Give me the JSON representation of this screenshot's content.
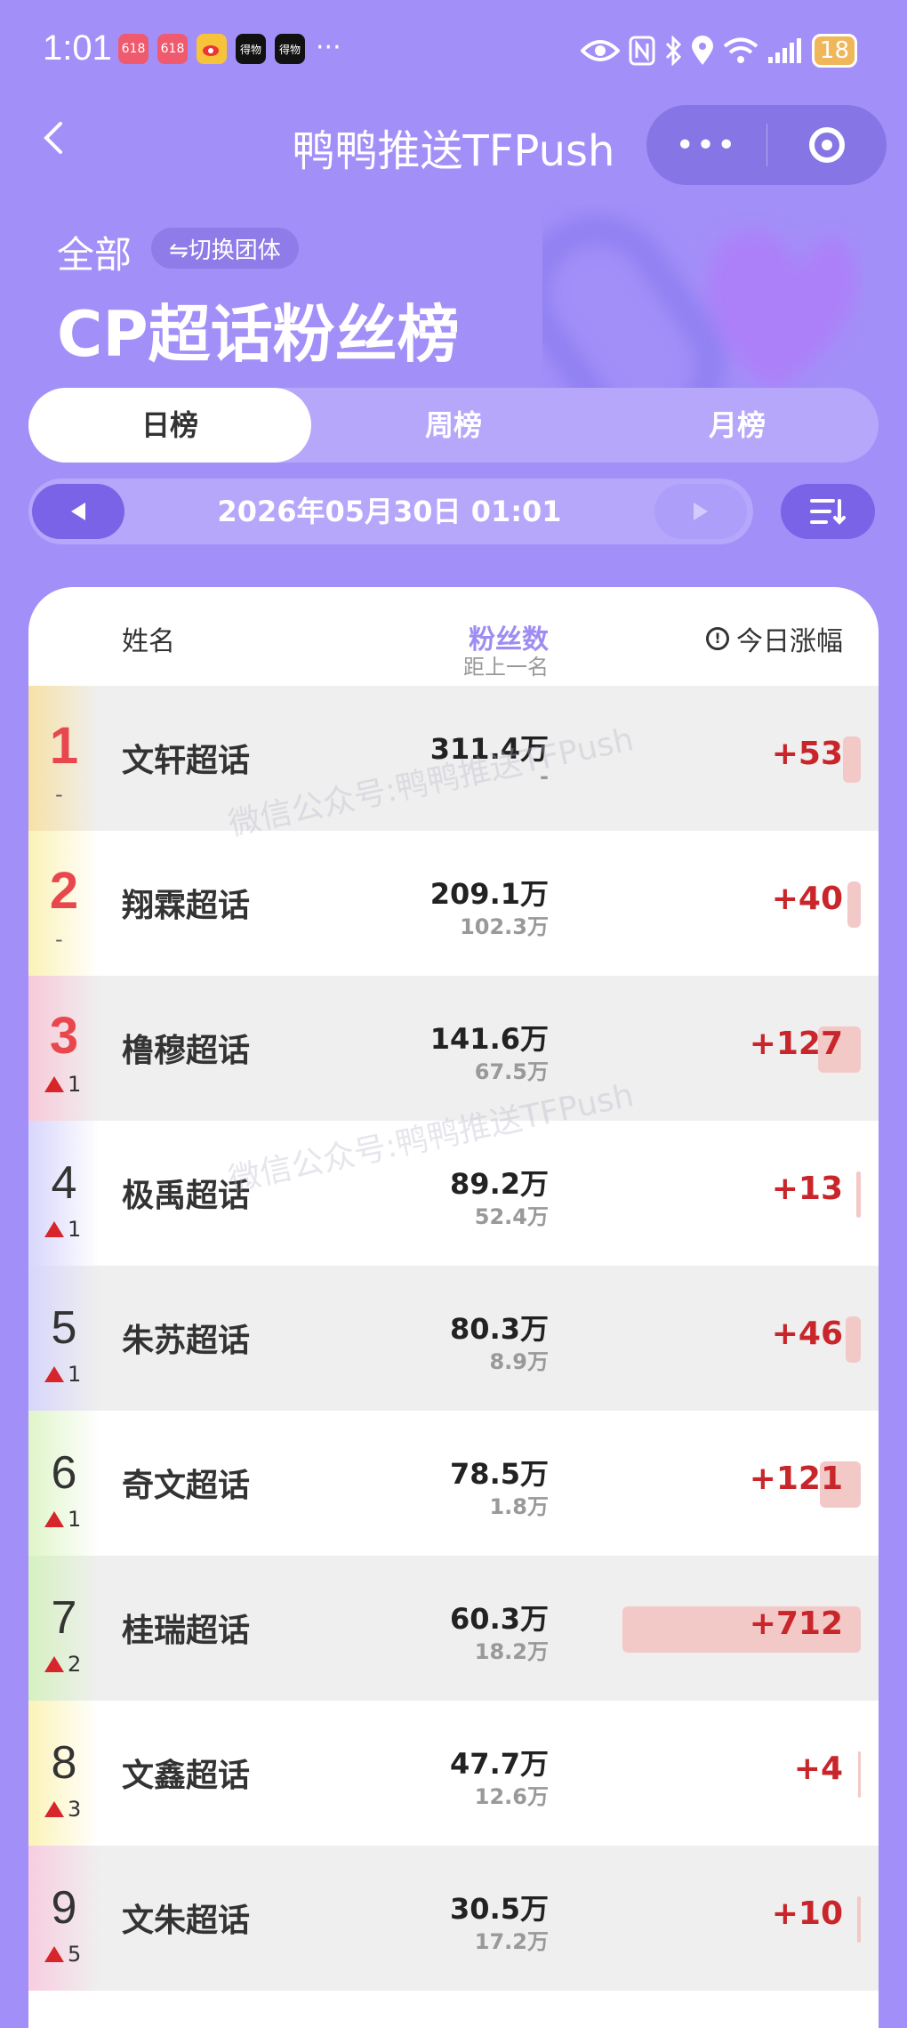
{
  "status": {
    "time": "1:01",
    "battery": "18",
    "icons": [
      "app-icon-618",
      "app-icon-618",
      "weibo-icon",
      "dewu-icon",
      "dewu-icon",
      "more-dots",
      "eye-icon",
      "nfc-icon",
      "bluetooth-icon",
      "location-icon",
      "wifi-icon",
      "signal-icon",
      "battery-icon"
    ],
    "app_icon_labels": [
      "618",
      "618",
      "",
      "得物",
      "得物"
    ],
    "more": "···"
  },
  "header": {
    "title": "鸭鸭推送TFPush",
    "menu_dots": "•••"
  },
  "heading": {
    "scope": "全部",
    "switch_label": "⇋切换团体",
    "title": "CP超话粉丝榜"
  },
  "tabs": [
    {
      "label": "日榜",
      "active": true
    },
    {
      "label": "周榜",
      "active": false
    },
    {
      "label": "月榜",
      "active": false
    }
  ],
  "date": {
    "text": "2026年05月30日 01:01"
  },
  "table": {
    "col_name": "姓名",
    "col_fans": "粉丝数",
    "col_gap": "距上一名",
    "col_today": "今日涨幅"
  },
  "rows": [
    {
      "rank": "1",
      "change": "-",
      "name": "文轩超话",
      "fans": "311.4万",
      "gap": "-",
      "today": "+53",
      "bar_pct": 0.074,
      "accent": "#f7e1a6"
    },
    {
      "rank": "2",
      "change": "-",
      "name": "翔霖超话",
      "fans": "209.1万",
      "gap": "102.3万",
      "today": "+40",
      "bar_pct": 0.056,
      "accent": "#fbf2b8"
    },
    {
      "rank": "3",
      "change": "1",
      "name": "橹穆超话",
      "fans": "141.6万",
      "gap": "67.5万",
      "today": "+127",
      "bar_pct": 0.178,
      "accent": "#f8c9d8"
    },
    {
      "rank": "4",
      "change": "1",
      "name": "极禹超话",
      "fans": "89.2万",
      "gap": "52.4万",
      "today": "+13",
      "bar_pct": 0.018,
      "accent": "#d8d6fb"
    },
    {
      "rank": "5",
      "change": "1",
      "name": "朱苏超话",
      "fans": "80.3万",
      "gap": "8.9万",
      "today": "+46",
      "bar_pct": 0.065,
      "accent": "#d8d6fb"
    },
    {
      "rank": "6",
      "change": "1",
      "name": "奇文超话",
      "fans": "78.5万",
      "gap": "1.8万",
      "today": "+121",
      "bar_pct": 0.17,
      "accent": "#dff5c9"
    },
    {
      "rank": "7",
      "change": "2",
      "name": "桂瑞超话",
      "fans": "60.3万",
      "gap": "18.2万",
      "today": "+712",
      "bar_pct": 1.0,
      "accent": "#d6f1c0"
    },
    {
      "rank": "8",
      "change": "3",
      "name": "文鑫超话",
      "fans": "47.7万",
      "gap": "12.6万",
      "today": "+4",
      "bar_pct": 0.006,
      "accent": "#fbf3b8"
    },
    {
      "rank": "9",
      "change": "5",
      "name": "文朱超话",
      "fans": "30.5万",
      "gap": "17.2万",
      "today": "+10",
      "bar_pct": 0.014,
      "accent": "#f8cde0"
    }
  ],
  "watermark": "微信公众号:鸭鸭推送TFPush"
}
